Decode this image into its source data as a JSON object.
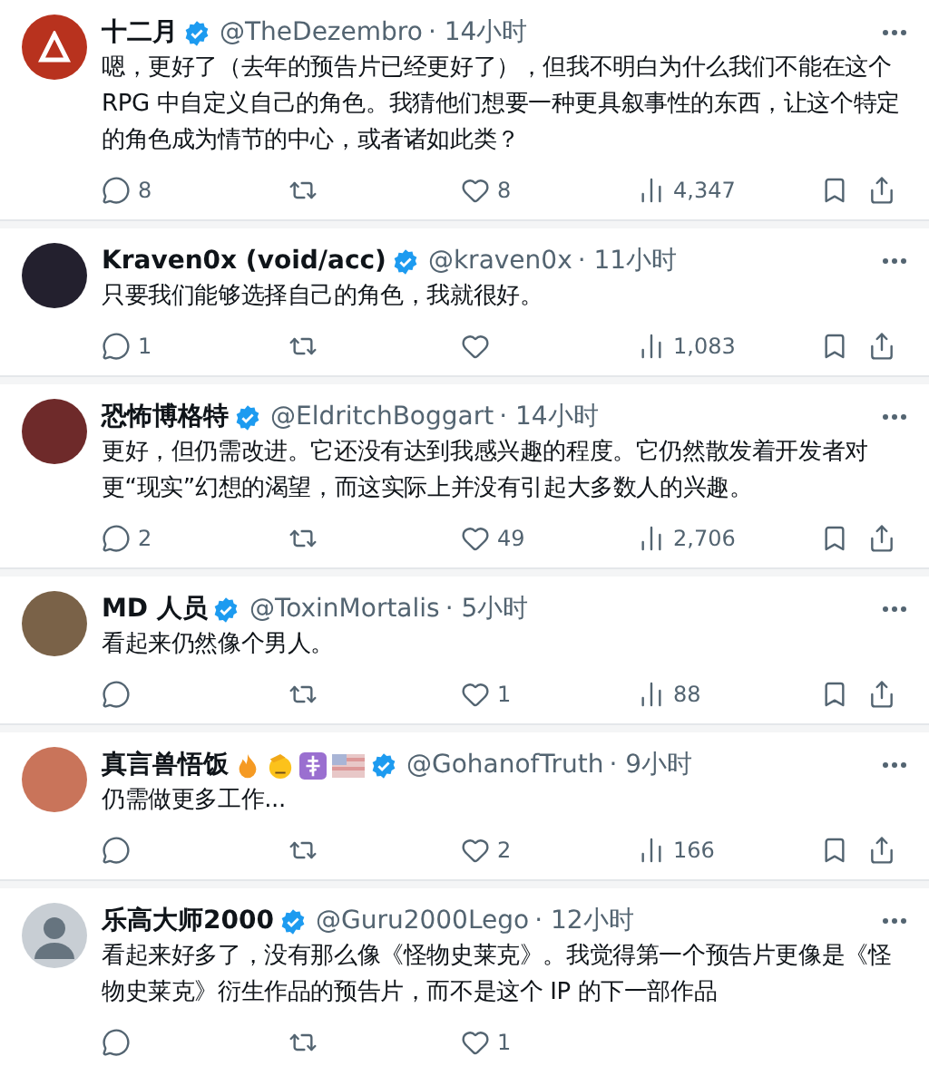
{
  "tweets": [
    {
      "name": "十二月",
      "handle": "@TheDezembro",
      "time": "· 14小时",
      "avatar": {
        "kind": "logo",
        "color": "#b8321e"
      },
      "text": "嗯，更好了（去年的预告片已经更好了），但我不明白为什么我们不能在这个 RPG 中自定义自己的角色。我猜他们想要一种更具叙事性的东西，让这个特定的角色成为情节的中心，或者诸如此类？",
      "actions": [
        {
          "kind": "reply",
          "count": "8"
        },
        {
          "kind": "retweet"
        },
        {
          "kind": "like",
          "count": "8"
        },
        {
          "kind": "views",
          "count": "4,347"
        },
        {
          "kind": "bookmark"
        },
        {
          "kind": "share"
        }
      ]
    },
    {
      "name": "Kraven0x (void/acc)",
      "handle": "@kraven0x",
      "time": "· 11小时",
      "avatar": {
        "kind": "photo",
        "color": "#23202e"
      },
      "text": "只要我们能够选择自己的角色，我就很好。",
      "actions": [
        {
          "kind": "reply",
          "count": "1"
        },
        {
          "kind": "retweet"
        },
        {
          "kind": "like"
        },
        {
          "kind": "views",
          "count": "1,083"
        },
        {
          "kind": "bookmark"
        },
        {
          "kind": "share"
        }
      ]
    },
    {
      "name": "恐怖博格特",
      "handle": "@EldritchBoggart",
      "time": "· 14小时",
      "avatar": {
        "kind": "photo",
        "color": "#6e2a2a"
      },
      "text": "更好，但仍需改进。它还没有达到我感兴趣的程度。它仍然散发着开发者对更“现实”幻想的渴望，而这实际上并没有引起大多数人的兴趣。",
      "actions": [
        {
          "kind": "reply",
          "count": "2"
        },
        {
          "kind": "retweet"
        },
        {
          "kind": "like",
          "count": "49"
        },
        {
          "kind": "views",
          "count": "2,706"
        },
        {
          "kind": "bookmark"
        },
        {
          "kind": "share"
        }
      ]
    },
    {
      "name": "MD 人员",
      "handle": "@ToxinMortalis",
      "time": "· 5小时",
      "avatar": {
        "kind": "photo",
        "color": "#7a6248"
      },
      "text": "看起来仍然像个男人。",
      "actions": [
        {
          "kind": "reply"
        },
        {
          "kind": "retweet"
        },
        {
          "kind": "like",
          "count": "1"
        },
        {
          "kind": "views",
          "count": "88"
        },
        {
          "kind": "bookmark"
        },
        {
          "kind": "share"
        }
      ]
    },
    {
      "name": "真言兽悟饭",
      "handle": "@GohanofTruth",
      "time": "· 9小时",
      "avatar": {
        "kind": "photo",
        "color": "#c9745a"
      },
      "emoji": [
        {
          "kind": "flame"
        },
        {
          "kind": "salute"
        },
        {
          "kind": "cross"
        },
        {
          "kind": "flag"
        }
      ],
      "text": "仍需做更多工作...",
      "actions": [
        {
          "kind": "reply"
        },
        {
          "kind": "retweet"
        },
        {
          "kind": "like",
          "count": "2"
        },
        {
          "kind": "views",
          "count": "166"
        },
        {
          "kind": "bookmark"
        },
        {
          "kind": "share"
        }
      ]
    },
    {
      "name": "乐高大师2000",
      "handle": "@Guru2000Lego",
      "time": "· 12小时",
      "avatar": {
        "kind": "default",
        "color": "#c8ced4"
      },
      "text": "看起来好多了，没有那么像《怪物史莱克》。我觉得第一个预告片更像是《怪物史莱克》衍生作品的预告片，而不是这个 IP 的下一部作品",
      "actions": [
        {
          "kind": "reply"
        },
        {
          "kind": "retweet"
        },
        {
          "kind": "like",
          "count": "1"
        }
      ]
    }
  ]
}
